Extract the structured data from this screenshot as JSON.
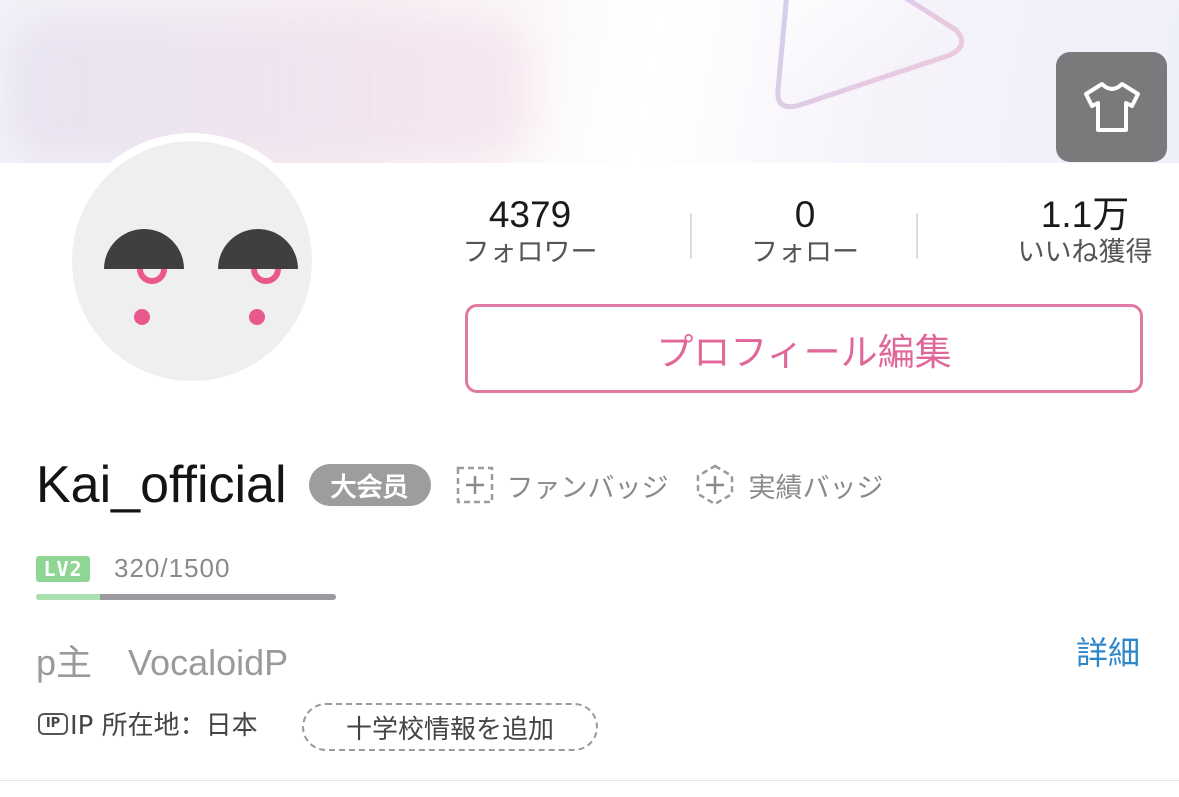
{
  "stats": {
    "followers": {
      "value": "4379",
      "label": "フォロワー"
    },
    "following": {
      "value": "0",
      "label": "フォロー"
    },
    "likes": {
      "value": "1.1万",
      "label": "いいね獲得"
    }
  },
  "edit_profile_label": "プロフィール編集",
  "user": {
    "name": "Kai_official",
    "vip_badge": "大会员"
  },
  "badges": {
    "fan_badge": "ファンバッジ",
    "achievement_badge": "実績バッジ"
  },
  "level": {
    "icon_text": "LV2",
    "exp_text": "320/1500",
    "progress": 0.213
  },
  "bio": "p主　VocaloidP",
  "detail_link": "詳細",
  "ip": {
    "icon_text": "IP",
    "location": "IP 所在地：日本"
  },
  "school_button": "十学校情報を追加",
  "colors": {
    "accent_pink": "#e07aa2",
    "link_blue": "#2f86c8",
    "level_green": "#8fd694",
    "vip_gray": "#9d9d9d"
  },
  "icons": [
    "tshirt-icon",
    "fan-badge-icon",
    "achievement-badge-icon",
    "ip-icon"
  ]
}
